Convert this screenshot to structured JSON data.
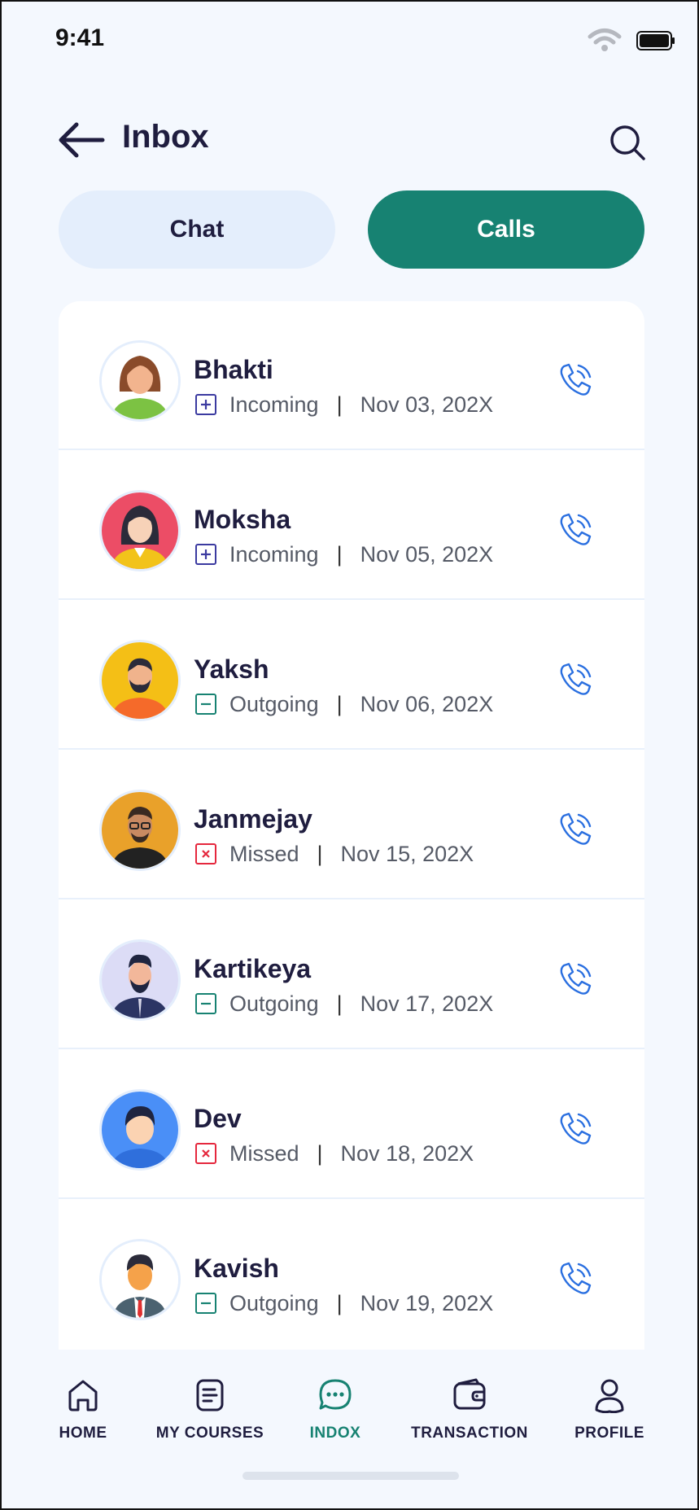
{
  "status_bar": {
    "time": "9:41"
  },
  "header": {
    "title": "Inbox"
  },
  "tabs": [
    {
      "label": "Chat",
      "active": false
    },
    {
      "label": "Calls",
      "active": true
    }
  ],
  "calls": [
    {
      "name": "Bhakti",
      "type": "Incoming",
      "date": "Nov 03, 202X",
      "avatar": "woman-green"
    },
    {
      "name": "Moksha",
      "type": "Incoming",
      "date": "Nov 05, 202X",
      "avatar": "woman-red"
    },
    {
      "name": "Yaksh",
      "type": "Outgoing",
      "date": "Nov 06, 202X",
      "avatar": "man-beard-yellow"
    },
    {
      "name": "Janmejay",
      "type": "Missed",
      "date": "Nov 15, 202X",
      "avatar": "man-glasses-orange"
    },
    {
      "name": "Kartikeya",
      "type": "Outgoing",
      "date": "Nov 17, 202X",
      "avatar": "man-beard-lavender"
    },
    {
      "name": "Dev",
      "type": "Missed",
      "date": "Nov 18, 202X",
      "avatar": "boy-blue"
    },
    {
      "name": "Kavish",
      "type": "Outgoing",
      "date": "Nov 19, 202X",
      "avatar": "man-suit-white"
    }
  ],
  "call_type_colors": {
    "Incoming": "#3b3aa0",
    "Outgoing": "#178272",
    "Missed": "#e5273d"
  },
  "accent_color": "#178272",
  "phone_icon_color": "#2a6fe0",
  "nav": [
    {
      "label": "HOME",
      "icon": "home-icon",
      "active": false
    },
    {
      "label": "MY COURSES",
      "icon": "document-icon",
      "active": false
    },
    {
      "label": "INDOX",
      "icon": "chat-bubble-icon",
      "active": true
    },
    {
      "label": "TRANSACTION",
      "icon": "wallet-icon",
      "active": false
    },
    {
      "label": "PROFILE",
      "icon": "user-icon",
      "active": false
    }
  ]
}
